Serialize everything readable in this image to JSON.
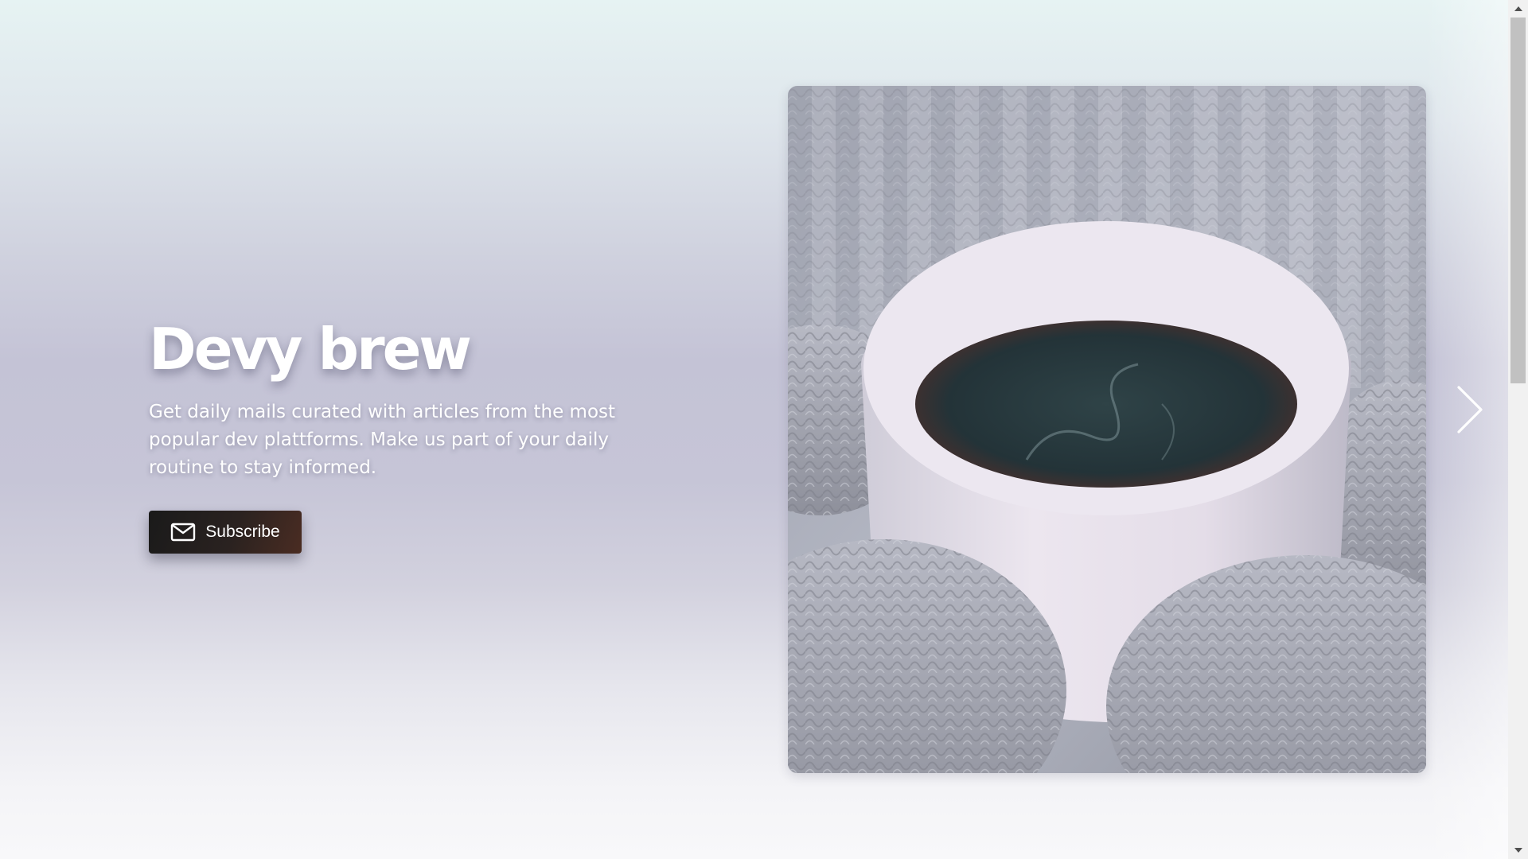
{
  "hero": {
    "title": "Devy brew",
    "description": "Get daily mails curated with articles from the most popular dev plattforms. Make us part of your daily routine to stay informed.",
    "subscribe_label": "Subscribe",
    "subscribe_icon": "mail-icon",
    "image_icon": "coffee-cup-photo"
  },
  "carousel": {
    "next_icon": "chevron-right-icon"
  },
  "colors": {
    "button_start": "#1a1a1a",
    "button_end": "#4a2c22",
    "text": "#ffffff"
  }
}
